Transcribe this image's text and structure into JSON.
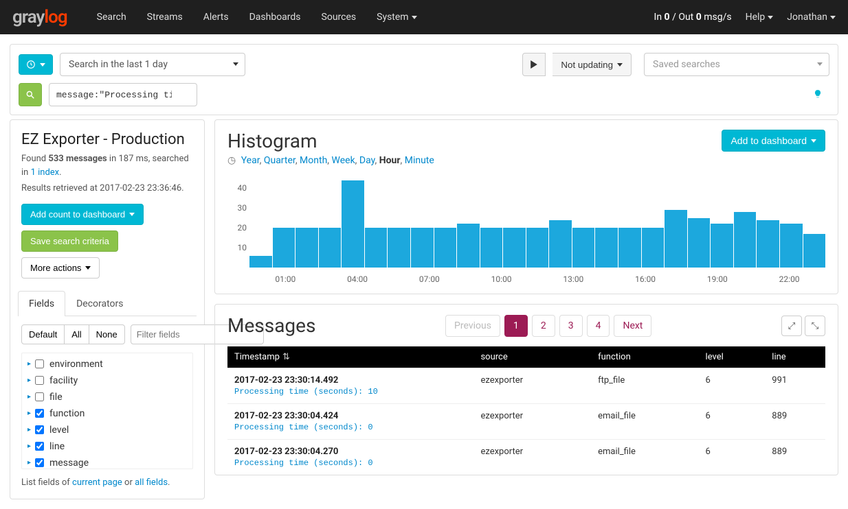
{
  "brand": {
    "gray": "gray",
    "log": "log"
  },
  "nav": {
    "links": [
      "Search",
      "Streams",
      "Alerts",
      "Dashboards",
      "Sources",
      "System"
    ],
    "io": "In 0 / Out 0 msg/s",
    "help": "Help",
    "user": "Jonathan"
  },
  "search": {
    "timerange": "Search in the last 1 day",
    "updating": "Not updating",
    "saved_placeholder": "Saved searches",
    "query": "message:\"Processing time\" AND (function:download_file OR function:email_file OR function:ftp_file)|"
  },
  "sidebar": {
    "title": "EZ Exporter - Production",
    "found_prefix": "Found ",
    "found_count": "533 messages",
    "found_suffix": " in 187 ms, searched in ",
    "index_link": "1 index",
    "results_time": "Results retrieved at 2017-02-23 23:36:46.",
    "btn_add": "Add count to dashboard",
    "btn_save": "Save search criteria",
    "btn_more": "More actions",
    "tabs": [
      "Fields",
      "Decorators"
    ],
    "filter_buttons": [
      "Default",
      "All",
      "None"
    ],
    "filter_placeholder": "Filter fields",
    "fields": [
      {
        "name": "environment",
        "checked": false
      },
      {
        "name": "facility",
        "checked": false
      },
      {
        "name": "file",
        "checked": false
      },
      {
        "name": "function",
        "checked": true
      },
      {
        "name": "level",
        "checked": true
      },
      {
        "name": "line",
        "checked": true
      },
      {
        "name": "message",
        "checked": true
      }
    ],
    "footer_prefix": "List fields of ",
    "footer_link1": "current page",
    "footer_mid": " or ",
    "footer_link2": "all fields",
    "footer_suffix": "."
  },
  "histogram": {
    "title": "Histogram",
    "btn_add": "Add to dashboard",
    "time_options": [
      "Year",
      "Quarter",
      "Month",
      "Week",
      "Day",
      "Hour",
      "Minute"
    ],
    "time_active": "Hour"
  },
  "chart_data": {
    "type": "bar",
    "ylim": [
      0,
      45
    ],
    "y_ticks": [
      10,
      20,
      30,
      40
    ],
    "x_ticks": [
      "01:00",
      "04:00",
      "07:00",
      "10:00",
      "13:00",
      "16:00",
      "19:00",
      "22:00"
    ],
    "values": [
      6,
      20,
      20,
      20,
      44,
      20,
      20,
      20,
      20,
      22,
      20,
      20,
      20,
      24,
      20,
      20,
      20,
      20,
      29,
      25,
      22,
      28,
      24,
      22,
      17
    ]
  },
  "messages": {
    "title": "Messages",
    "prev": "Previous",
    "pages": [
      "1",
      "2",
      "3",
      "4"
    ],
    "next": "Next",
    "columns": [
      "Timestamp",
      "source",
      "function",
      "level",
      "line"
    ],
    "rows": [
      {
        "ts": "2017-02-23 23:30:14.492",
        "source": "ezexporter",
        "function": "ftp_file",
        "level": "6",
        "line": "991",
        "msg": "Processing time (seconds): 10"
      },
      {
        "ts": "2017-02-23 23:30:04.424",
        "source": "ezexporter",
        "function": "email_file",
        "level": "6",
        "line": "889",
        "msg": "Processing time (seconds): 0"
      },
      {
        "ts": "2017-02-23 23:30:04.270",
        "source": "ezexporter",
        "function": "email_file",
        "level": "6",
        "line": "889",
        "msg": "Processing time (seconds): 0"
      }
    ]
  }
}
